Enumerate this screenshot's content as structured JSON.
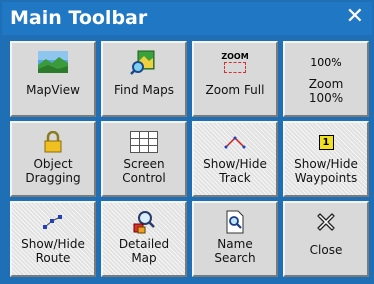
{
  "window": {
    "title": "Main Toolbar",
    "close_glyph": "✕"
  },
  "buttons": [
    {
      "line1": "MapView",
      "line2": "",
      "icon": "landscape-icon"
    },
    {
      "line1": "Find Maps",
      "line2": "",
      "icon": "find-maps-icon"
    },
    {
      "line1": "Zoom Full",
      "line2": "",
      "icon": "zoom-full-icon",
      "icon_text": "ZOOM"
    },
    {
      "line1": "Zoom",
      "line2": "100%",
      "icon": "zoom-100-icon",
      "icon_text": "100%"
    },
    {
      "line1": "Object",
      "line2": "Dragging",
      "icon": "lock-icon"
    },
    {
      "line1": "Screen",
      "line2": "Control",
      "icon": "grid-icon"
    },
    {
      "line1": "Show/Hide",
      "line2": "Track",
      "icon": "track-icon"
    },
    {
      "line1": "Show/Hide",
      "line2": "Waypoints",
      "icon": "waypoint-icon",
      "icon_text": "1"
    },
    {
      "line1": "Show/Hide",
      "line2": "Route",
      "icon": "route-icon"
    },
    {
      "line1": "Detailed",
      "line2": "Map",
      "icon": "detailed-map-icon"
    },
    {
      "line1": "Name",
      "line2": "Search",
      "icon": "name-search-icon"
    },
    {
      "line1": "Close",
      "line2": "",
      "icon": "close-icon"
    }
  ],
  "colors": {
    "titlebar": "#2077c4",
    "button_face": "#d9d9d9"
  }
}
